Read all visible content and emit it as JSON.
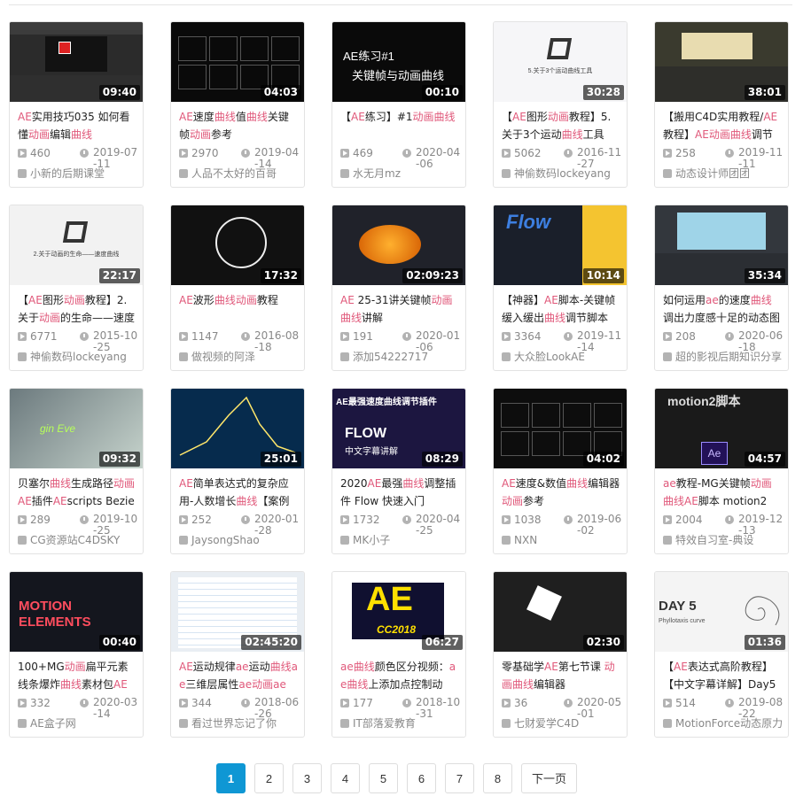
{
  "videos": [
    {
      "title": "AE实用技巧035 如何看懂动画编辑曲线",
      "views": "460",
      "date": "2019-07-11",
      "author": "小新的后期课堂",
      "duration": "09:40"
    },
    {
      "title": "AE速度曲线值曲线关键帧动画参考",
      "views": "2970",
      "date": "2019-04-14",
      "author": "人品不太好的百哥",
      "duration": "04:03"
    },
    {
      "title": "【AE练习】#1动画曲线",
      "views": "469",
      "date": "2020-04-06",
      "author": "水无月mz",
      "duration": "00:10",
      "thumb_line1": "AE练习#1",
      "thumb_line2": "关键帧与动画曲线"
    },
    {
      "title": "【AE图形动画教程】5.关于3个运动曲线工具",
      "views": "5062",
      "date": "2016-11-27",
      "author": "神偷数码lockeyang",
      "duration": "30:28",
      "thumb_caption": "5.关于3个运动曲线工具"
    },
    {
      "title": "【搬用C4D实用教程/AE教程】AE动画曲线调节",
      "views": "258",
      "date": "2019-11-11",
      "author": "动态设计师团团",
      "duration": "38:01"
    },
    {
      "title": "【AE图形动画教程】2.关于动画的生命——速度",
      "views": "6771",
      "date": "2015-10-25",
      "author": "神偷数码lockeyang",
      "duration": "22:17",
      "thumb_caption": "2.关于动画的生命——速度曲线"
    },
    {
      "title": "AE波形曲线动画教程",
      "views": "1147",
      "date": "2016-08-18",
      "author": "做视频的阿泽",
      "duration": "17:32"
    },
    {
      "title": "AE 25-31讲关键帧动画曲线讲解",
      "views": "191",
      "date": "2020-01-06",
      "author": "添加54222717",
      "duration": "02:09:23"
    },
    {
      "title": "【神器】AE脚本-关键帧缓入缓出曲线调节脚本",
      "views": "3364",
      "date": "2019-11-14",
      "author": "大众脸LookAE",
      "duration": "10:14",
      "thumb_text": "Flow"
    },
    {
      "title": "如何运用ae的速度曲线调出力度感十足的动态图",
      "views": "208",
      "date": "2020-06-18",
      "author": "超的影视后期知识分享",
      "duration": "35:34"
    },
    {
      "title": "贝塞尔曲线生成路径动画AE插件AEscripts Bezier",
      "views": "289",
      "date": "2019-10-25",
      "author": "CG资源站C4DSKY",
      "duration": "09:32",
      "thumb_text": "gin Eve"
    },
    {
      "title": "AE简单表达式的复杂应用-人数增长曲线【案例",
      "views": "252",
      "date": "2020-01-28",
      "author": "JaysongShao",
      "duration": "25:01"
    },
    {
      "title": "2020AE最强曲线调整插件 Flow 快速入门",
      "views": "1732",
      "date": "2020-04-25",
      "author": "MK小子",
      "duration": "08:29",
      "thumb_top": "AE最强速度曲线调节插件",
      "thumb_big": "FLOW",
      "thumb_sub": "中文字幕讲解"
    },
    {
      "title": "AE速度&数值曲线编辑器动画参考",
      "views": "1038",
      "date": "2019-06-02",
      "author": "NXN",
      "duration": "04:02"
    },
    {
      "title": "ae教程-MG关键帧动画曲线AE脚本 motion2",
      "views": "2004",
      "date": "2019-12-13",
      "author": "特效自习室-典设",
      "duration": "04:57",
      "thumb_text": "motion2脚本",
      "thumb_badge": "Ae"
    },
    {
      "title": "100+MG动画扁平元素线条爆炸曲线素材包AE模",
      "views": "332",
      "date": "2020-03-14",
      "author": "AE盒子网",
      "duration": "00:40",
      "thumb_line1": "MOTION",
      "thumb_line2": "ELEMENTS"
    },
    {
      "title": "AE运动规律ae运动曲线ae三维层属性ae动画ae",
      "views": "344",
      "date": "2018-06-26",
      "author": "看过世界忘记了你",
      "duration": "02:45:20"
    },
    {
      "title": "ae曲线颜色区分视频：ae曲线上添加点控制动",
      "views": "177",
      "date": "2018-10-31",
      "author": "IT部落爱教育",
      "duration": "06:27",
      "thumb_line1": "AE",
      "thumb_line2": "CC2018"
    },
    {
      "title": "零基础学AE第七节课 动画曲线编辑器",
      "views": "36",
      "date": "2020-05-01",
      "author": "七财爱学C4D",
      "duration": "02:30"
    },
    {
      "title": "【AE表达式高阶教程】【中文字幕详解】Day5",
      "views": "514",
      "date": "2019-08-22",
      "author": "MotionForce动态原力",
      "duration": "01:36",
      "thumb_line1": "DAY 5",
      "thumb_line2": "Phyllotaxis curve"
    }
  ],
  "pagination": {
    "pages": [
      "1",
      "2",
      "3",
      "4",
      "5",
      "6",
      "7",
      "8"
    ],
    "current": "1",
    "next": "下一页"
  }
}
